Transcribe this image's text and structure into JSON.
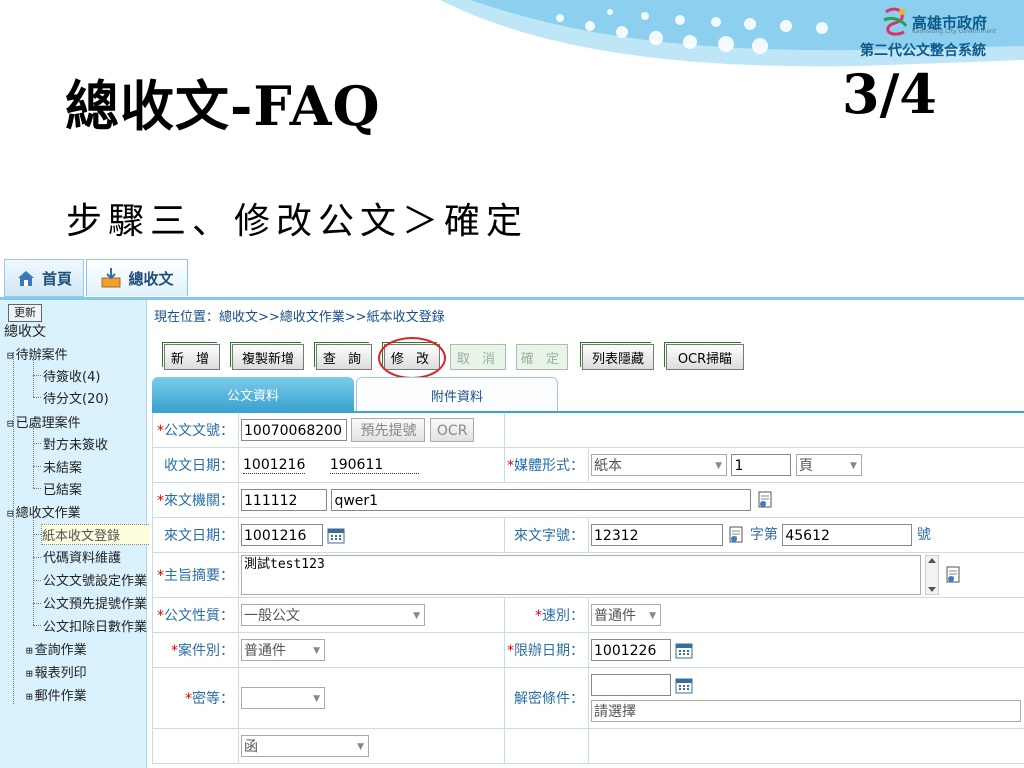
{
  "slide": {
    "title": "總收文-FAQ",
    "page": "3/4",
    "step": "步驟三、修改公文＞確定",
    "logo": {
      "name": "高雄市政府",
      "en": "Kaohsiung City Government",
      "system": "第二代公文整合系統"
    }
  },
  "app": {
    "tabs": [
      {
        "label": "首頁",
        "icon": "home-icon"
      },
      {
        "label": "總收文",
        "icon": "inbox-download-icon"
      }
    ],
    "sidebar": {
      "refresh": "更新",
      "root": "總收文",
      "groups": [
        {
          "label": "待辦案件",
          "toggle": "⊟",
          "items": [
            "待簽收(4)",
            "待分文(20)"
          ]
        },
        {
          "label": "已處理案件",
          "toggle": "⊟",
          "items": [
            "對方未簽收",
            "未結案",
            "已結案"
          ]
        },
        {
          "label": "總收文作業",
          "toggle": "⊟",
          "items": [
            "紙本收文登錄",
            "代碼資料維護",
            "公文文號設定作業",
            "公文預先提號作業",
            "公文扣除日數作業"
          ],
          "selected": "紙本收文登錄"
        },
        {
          "label": "查詢作業",
          "toggle": "⊞",
          "items": []
        },
        {
          "label": "報表列印",
          "toggle": "⊞",
          "items": []
        },
        {
          "label": "郵件作業",
          "toggle": "⊞",
          "items": []
        }
      ]
    },
    "breadcrumb": "現在位置：總收文>>總收文作業>>紙本收文登錄",
    "toolbar": [
      {
        "label": "新 增",
        "enabled": true
      },
      {
        "label": "複製新增",
        "enabled": true
      },
      {
        "label": "查 詢",
        "enabled": true
      },
      {
        "label": "修 改",
        "enabled": true,
        "highlighted": true
      },
      {
        "label": "取 消",
        "enabled": false
      },
      {
        "label": "確 定",
        "enabled": false
      },
      {
        "label": "列表隱藏",
        "enabled": true
      },
      {
        "label": "OCR掃瞄",
        "enabled": true
      }
    ],
    "subtabs": [
      "公文資料",
      "附件資料"
    ],
    "form": {
      "doc_no": {
        "label": "公文文號：",
        "value": "10070068200",
        "btn_pre": "預先提號",
        "btn_ocr": "OCR"
      },
      "recv_date": {
        "label": "收文日期：",
        "date": "1001216",
        "time": "190611"
      },
      "media": {
        "label": "媒體形式：",
        "value": "紙本",
        "qty": "1",
        "unit": "頁"
      },
      "from_org": {
        "label": "來文機關：",
        "code": "111112",
        "name": "qwer1"
      },
      "from_date": {
        "label": "來文日期：",
        "value": "1001216"
      },
      "from_no": {
        "label": "來文字號：",
        "value": "12312",
        "word_label": "字第",
        "number": "45612",
        "suffix": "號"
      },
      "subject": {
        "label": "主旨摘要：",
        "value": "測試test123"
      },
      "nature": {
        "label": "公文性質：",
        "value": "一般公文"
      },
      "speed": {
        "label": "速別：",
        "value": "普通件"
      },
      "case_type": {
        "label": "案件別：",
        "value": "普通件"
      },
      "deadline": {
        "label": "限辦日期：",
        "value": "1001226"
      },
      "secret": {
        "label": "密等：",
        "value": ""
      },
      "declass": {
        "label": "解密條件：",
        "value": "",
        "select": "請選擇"
      },
      "last_row": {
        "value": "函"
      }
    }
  }
}
